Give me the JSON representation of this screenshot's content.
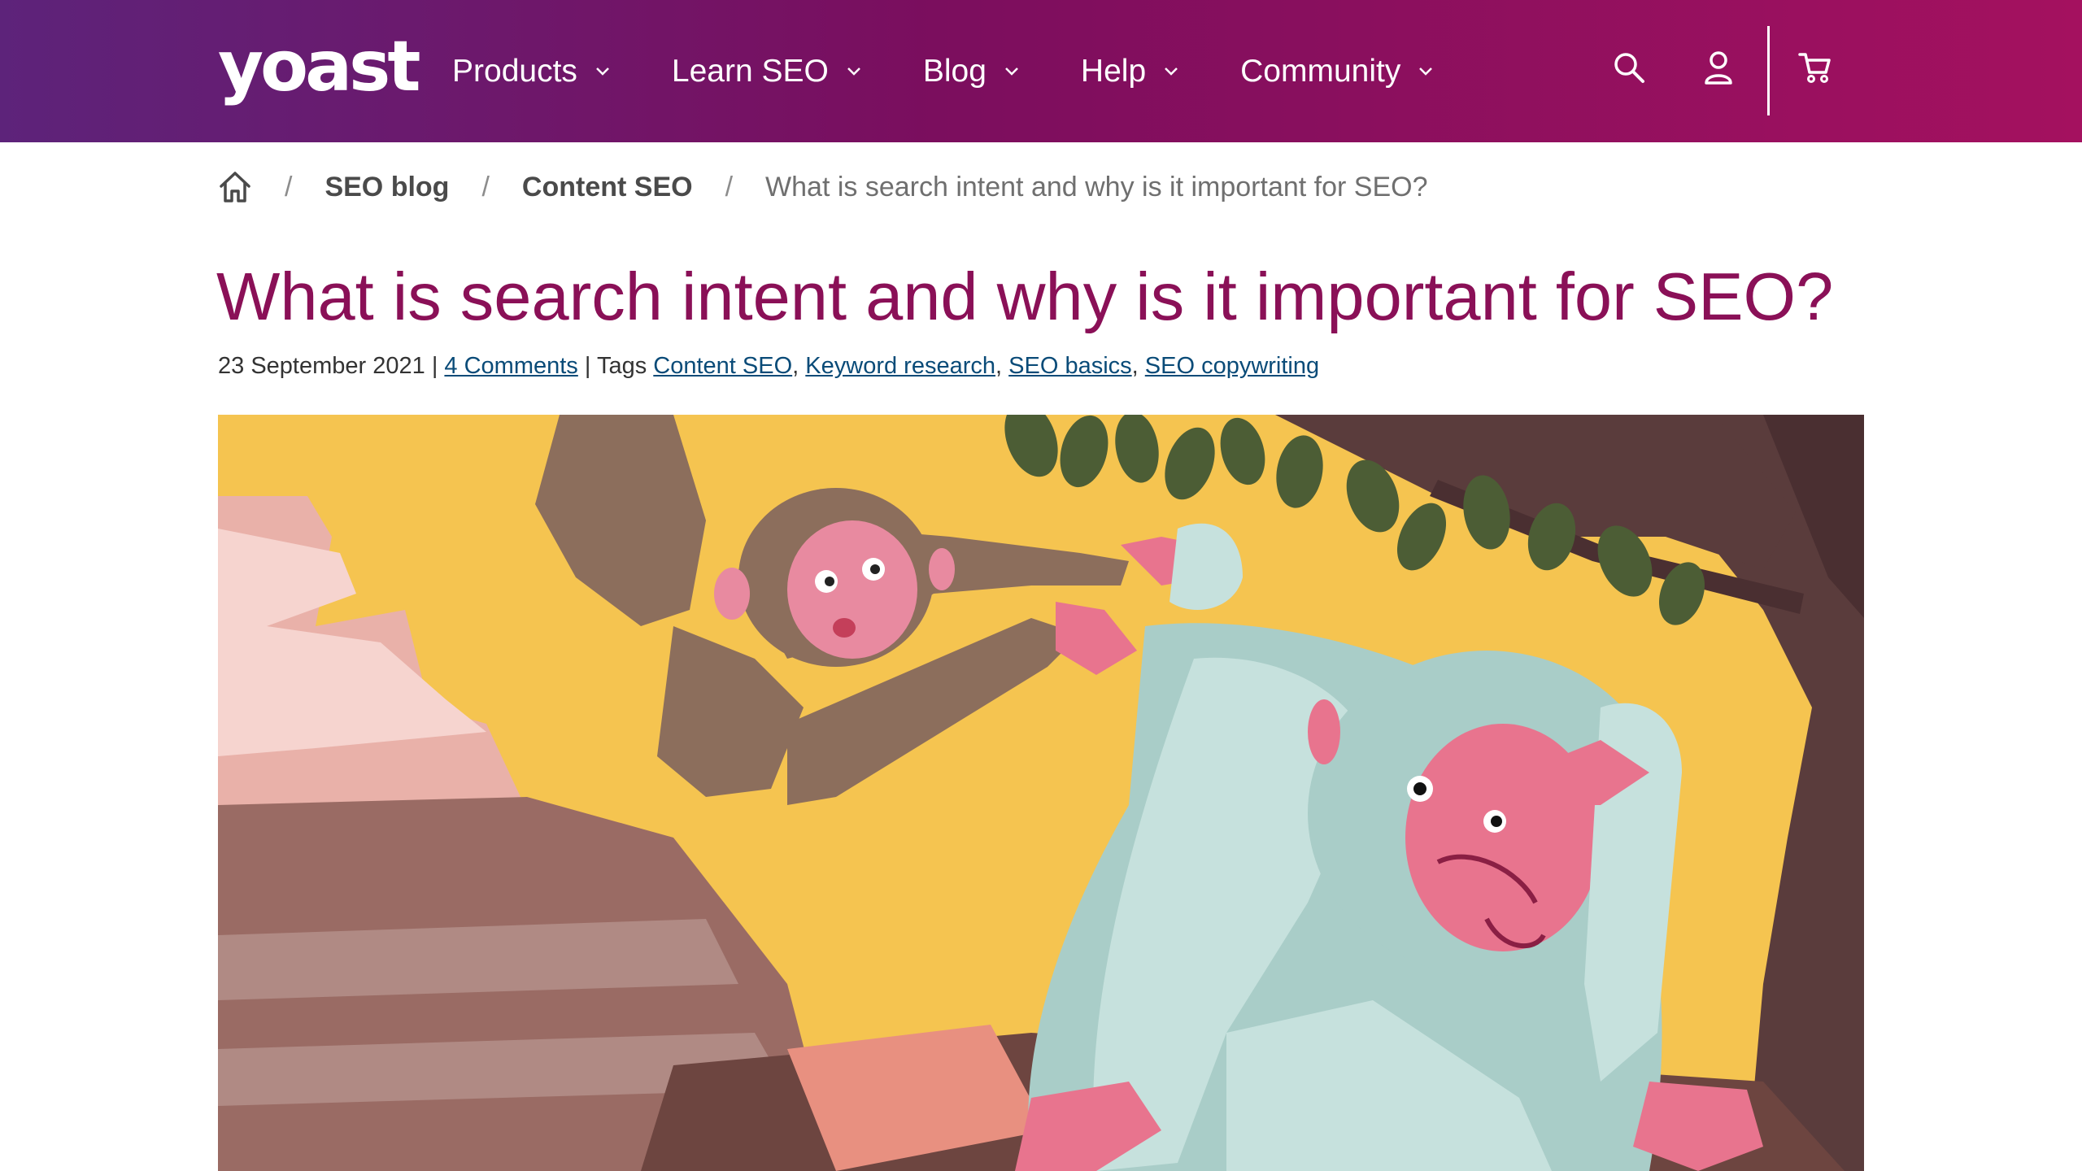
{
  "header": {
    "logo": "yoast",
    "nav": [
      {
        "label": "Products"
      },
      {
        "label": "Learn SEO"
      },
      {
        "label": "Blog"
      },
      {
        "label": "Help"
      },
      {
        "label": "Community"
      }
    ],
    "icons": [
      "search-icon",
      "user-icon",
      "cart-icon"
    ],
    "colors": {
      "gradient_start": "#5d237a",
      "gradient_end": "#a4115f"
    }
  },
  "breadcrumb": {
    "home_icon": "home-icon",
    "separator": "/",
    "items": [
      {
        "label": "SEO blog"
      },
      {
        "label": "Content SEO"
      }
    ],
    "current": "What is search intent and why is it important for SEO?"
  },
  "article": {
    "title": "What is search intent and why is it important for SEO?",
    "title_color": "#8a1057",
    "meta": {
      "date": "23 September 2021",
      "sep": "|",
      "comments": "4 Comments",
      "tags_label": "Tags",
      "tags": [
        "Content SEO",
        "Keyword research",
        "SEO basics",
        "SEO copywriting"
      ],
      "comma": ","
    },
    "hero_image": "illustration of a brown monkey hanging from a tree scratching the head of a pale white ape on rocks against a yellow background"
  }
}
